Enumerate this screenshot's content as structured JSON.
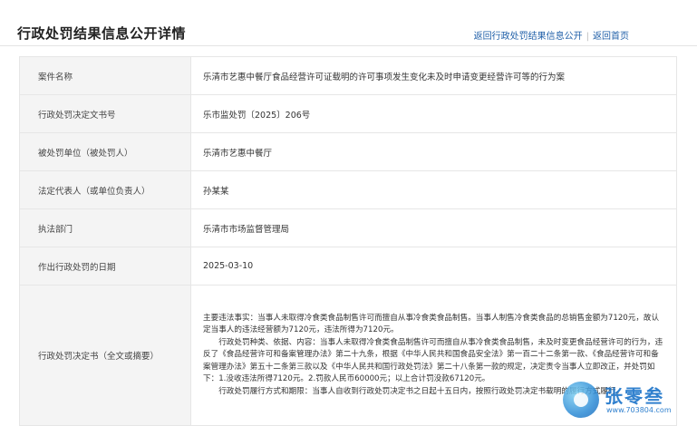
{
  "header": {
    "title": "行政处罚结果信息公开详情",
    "links": [
      "返回行政处罚结果信息公开",
      "返回首页"
    ]
  },
  "rows": [
    {
      "label": "案件名称",
      "value": "乐清市艺惠中餐厅食品经营许可证载明的许可事项发生变化未及时申请变更经营许可等的行为案"
    },
    {
      "label": "行政处罚决定文书号",
      "value": "乐市监处罚〔2025〕206号"
    },
    {
      "label": "被处罚单位（被处罚人）",
      "value": "乐清市艺惠中餐厅"
    },
    {
      "label": "法定代表人（或单位负责人）",
      "value": "孙某某"
    },
    {
      "label": "执法部门",
      "value": "乐清市市场监督管理局"
    },
    {
      "label": "作出行政处罚的日期",
      "value": "2025-03-10"
    },
    {
      "label": "行政处罚决定书（全文或摘要）",
      "paragraphs": [
        "主要违法事实：当事人未取得冷食类食品制售许可而擅自从事冷食类食品制售。当事人制售冷食类食品的总销售金额为7120元，故认定当事人的违法经营额为7120元，违法所得为7120元。",
        "行政处罚种类、依据、内容：当事人未取得冷食类食品制售许可而擅自从事冷食类食品制售，未及时变更食品经营许可的行为，违反了《食品经营许可和备案管理办法》第二十九条，根据《中华人民共和国食品安全法》第一百二十二条第一款、《食品经营许可和备案管理办法》第五十二条第三款以及《中华人民共和国行政处罚法》第二十八条第一款的规定，决定责令当事人立即改正，并处罚如下：1.没收违法所得7120元。2.罚款人民币60000元；以上合计罚没款67120元。",
        "行政处罚履行方式和期限：当事人自收到行政处罚决定书之日起十五日内，按照行政处罚决定书载明的履行方式履行。"
      ]
    }
  ],
  "watermark": {
    "name": "张零叁",
    "url": "www.703804.com"
  }
}
